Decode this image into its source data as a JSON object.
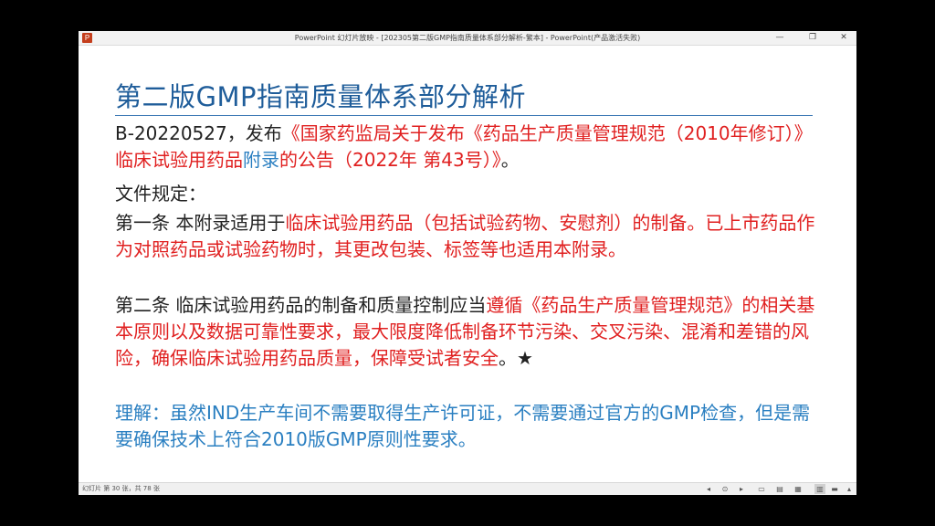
{
  "window": {
    "app_icon_letter": "P",
    "title": "PowerPoint 幻灯片放映 - [202305第二版GMP指南质量体系部分解析-繁本] - PowerPoint(产品激活失败)",
    "minimize_glyph": "—",
    "restore_glyph": "❐",
    "close_glyph": "✕"
  },
  "slide": {
    "title": "第二版GMP指南质量体系部分解析",
    "p1": {
      "a": "B-20220527，发布",
      "b": "《国家药监局关于发布《药品生产质量管理规范（2010年修订）》临床试验用药品",
      "c": "附录",
      "d": "的公告（2022年 第43号）》",
      "e": "。"
    },
    "p2": "文件规定：",
    "p3": {
      "a": "第一条  本附录适用于",
      "b": "临床试验用药品（包括试验药物、安慰剂）的制备。已上市药品作为对照药品或试验药物时，其更改包装、标签等也适用本附录。"
    },
    "p4": {
      "a": "第二条  临床试验用药品的制备和质量控制应当",
      "b": "遵循《药品生产质量管理规范》的相关基本原则以及数据可靠性要求，最大限度降低制备环节污染、交叉污染、混淆和差错的风险，确保临床试验用药品质量，保障受试者安全",
      "c": "。★"
    },
    "p5": "理解：虽然IND生产车间不需要取得生产许可证，不需要通过官方的GMP检查，但是需要确保技术上符合2010版GMP原则性要求。"
  },
  "statusbar": {
    "slide_counter": "幻灯片 第 30 张，共 78 张",
    "icons": [
      "◂",
      "⊙",
      "▸",
      "▭",
      "▤",
      "▦",
      "▥",
      "▬",
      "▴"
    ]
  }
}
